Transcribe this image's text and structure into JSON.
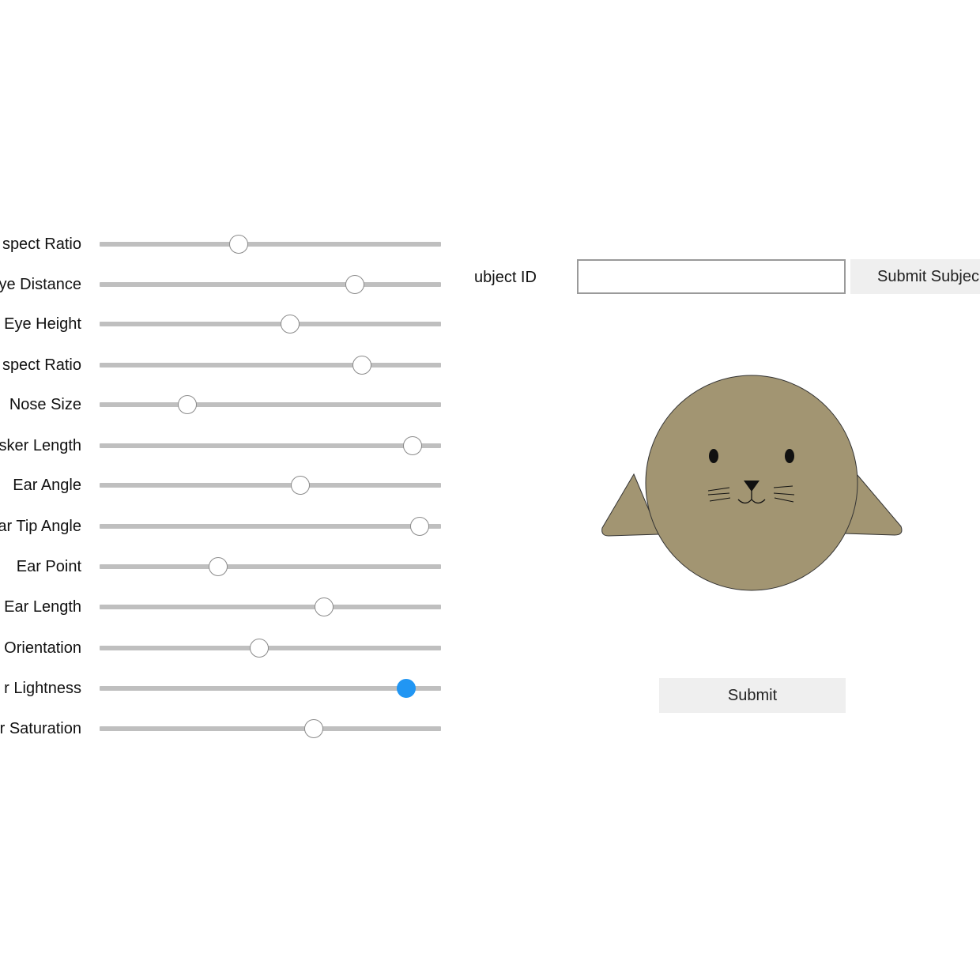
{
  "sliders": [
    {
      "label": "spect Ratio",
      "value": 0.41
    },
    {
      "label": "ye Distance",
      "value": 0.75
    },
    {
      "label": "Eye Height",
      "value": 0.56
    },
    {
      "label": "spect Ratio",
      "value": 0.77
    },
    {
      "label": "Nose Size",
      "value": 0.26
    },
    {
      "label": "sker Length",
      "value": 0.92
    },
    {
      "label": "Ear Angle",
      "value": 0.59
    },
    {
      "label": "ar Tip Angle",
      "value": 0.94
    },
    {
      "label": "Ear Point",
      "value": 0.35
    },
    {
      "label": "Ear Length",
      "value": 0.66
    },
    {
      "label": "Orientation",
      "value": 0.47
    },
    {
      "label": "r Lightness",
      "value": 0.9,
      "active": true
    },
    {
      "label": "r Saturation",
      "value": 0.63
    }
  ],
  "subject": {
    "label": "ubject ID",
    "input_value": "",
    "submit_label": "Submit Subjec"
  },
  "submit": {
    "label": "Submit"
  },
  "colors": {
    "fur": "#a29572",
    "outline": "#333333",
    "active_thumb": "#2196f3",
    "track": "#bfbfbf"
  }
}
